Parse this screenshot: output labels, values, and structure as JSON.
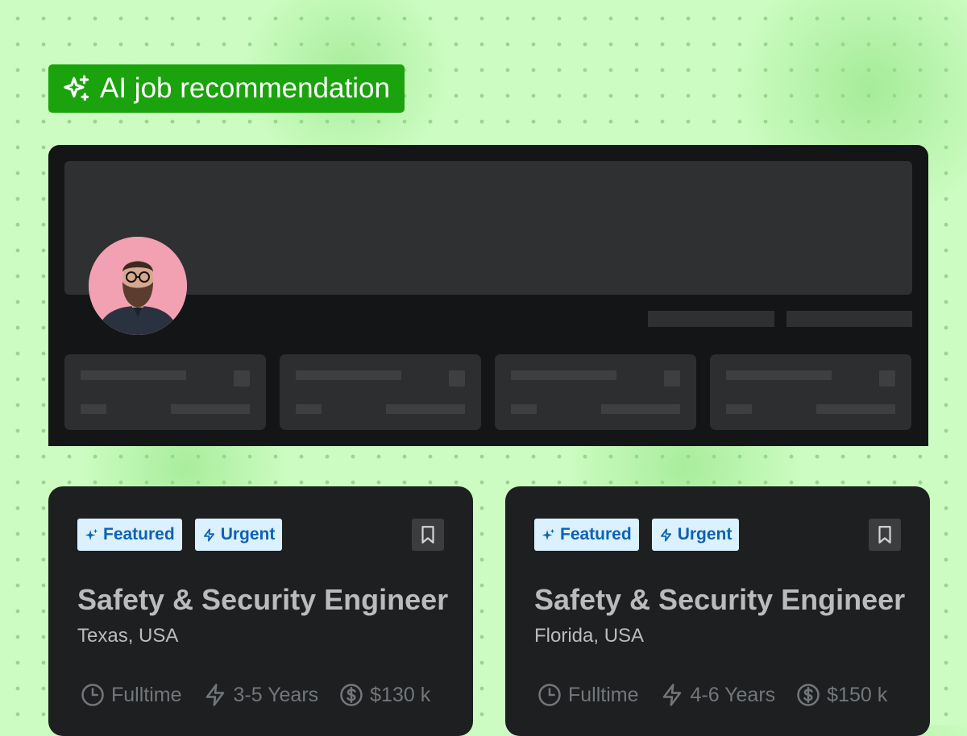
{
  "header": {
    "badge_label": "AI job recommendation",
    "badge_icon": "sparkles-icon",
    "accent": "#1aa30c"
  },
  "profile": {
    "avatar": "profile-avatar"
  },
  "jobs": [
    {
      "tags": [
        {
          "label": "Featured",
          "icon": "sparkle-icon"
        },
        {
          "label": "Urgent",
          "icon": "lightning-icon"
        }
      ],
      "title": "Safety & Security Engineer",
      "location": "Texas, USA",
      "employment": "Fulltime",
      "experience": "3-5 Years",
      "salary": "$130 k"
    },
    {
      "tags": [
        {
          "label": "Featured",
          "icon": "sparkle-icon"
        },
        {
          "label": "Urgent",
          "icon": "lightning-icon"
        }
      ],
      "title": "Safety & Security Engineer",
      "location": "Florida, USA",
      "employment": "Fulltime",
      "experience": "4-6 Years",
      "salary": "$150 k"
    }
  ],
  "colors": {
    "tag_bg": "#dbf1ff",
    "tag_text": "#0c62b6",
    "card_bg": "#1d1f21",
    "panel_bg": "#131517"
  }
}
